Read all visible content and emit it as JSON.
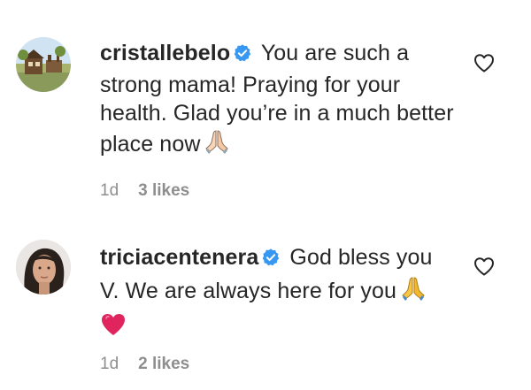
{
  "comments": [
    {
      "username": "cristallebelo",
      "verified": true,
      "text": "You are such a strong mama! Praying for your health. Glad you’re in a much better place now",
      "emoji": "folded-hands-icon",
      "time": "1d",
      "likes": "3 likes"
    },
    {
      "username": "triciacentenera",
      "verified": true,
      "text": "God bless you V. We are always here for you",
      "emoji": "folded-hands-icon",
      "extra_emoji": "red-heart-icon",
      "time": "1d",
      "likes": "2 likes"
    }
  ],
  "colors": {
    "text": "#262626",
    "meta": "#8e8e8e",
    "verified": "#3897f0",
    "heart": "#e0245e"
  }
}
